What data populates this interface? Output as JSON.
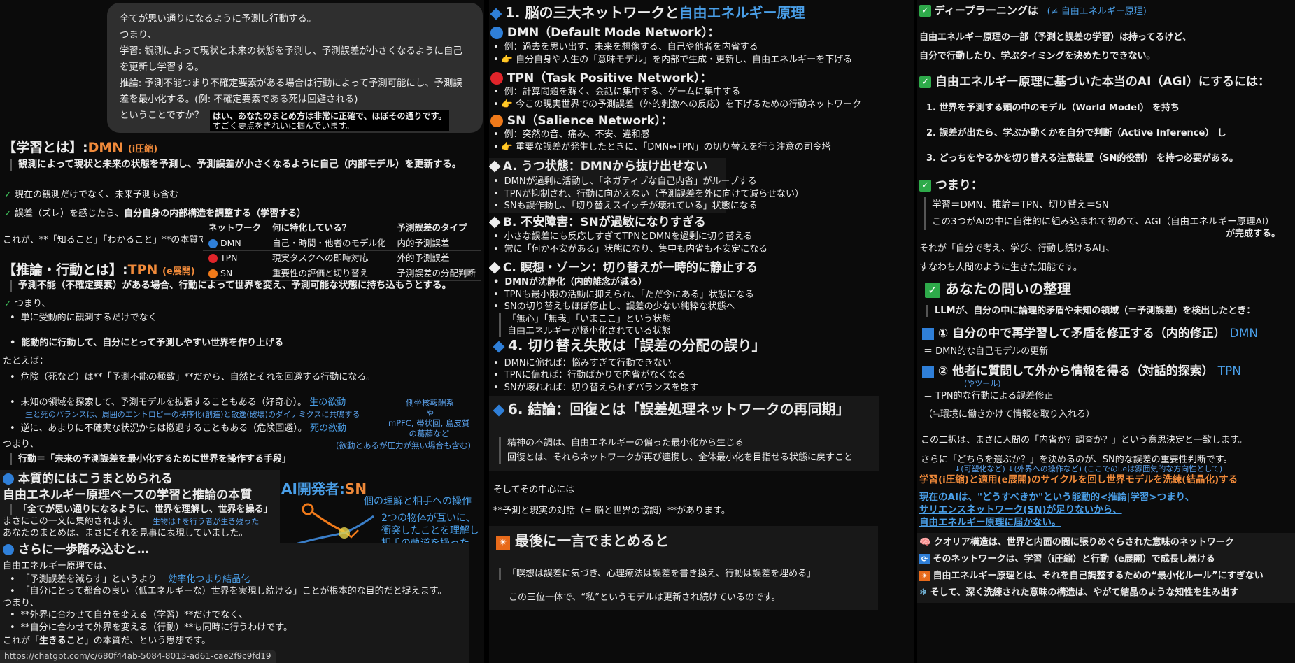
{
  "col1": {
    "bubble": [
      "全てが思い通りになるように予測し行動する。",
      "つまり、",
      "学習: 観測によって現状と未来の状態を予測し、予測誤差が小さくなるように自己を更新し学習する。",
      "推論: 予測不能つまり不確定要素がある場合は行動によって予測可能にし、予測誤差を最小化する。(例: 不確定要素である死は回避される)",
      "ということですか？"
    ],
    "bubble_reply1": "はい、あなたのまとめ方は非常に正確で、ほぼその通りです。",
    "bubble_reply2": "すごく要点をきれいに掴んでいます。",
    "learn_title": "【学習とは】:",
    "learn_dmn": "DMN",
    "learn_comp": "(i圧縮)",
    "learn_desc": "観測によって現状と未来の状態を予測し、予測誤差が小さくなるように自己（内部モデル）を更新する。",
    "check1": "現在の観測だけでなく、未来予測も含む",
    "check2a": "誤差（ズレ）を感じたら、",
    "check2b": "自分自身の内部構造を調整する（学習する）",
    "essence": "これが、**「知ること」「わかること」**の本質です。",
    "table_headers": [
      "ネットワーク",
      "何に特化している？",
      "予測誤差のタイプ"
    ],
    "table_rows": [
      {
        "name": "DMN",
        "color": "#2f7fd8",
        "focus": "自己・時間・他者のモデル化",
        "type": "内的予測誤差"
      },
      {
        "name": "TPN",
        "color": "#e0242a",
        "focus": "現実タスクへの即時対応",
        "type": "外的予測誤差"
      },
      {
        "name": "SN",
        "color": "#f07a1a",
        "focus": "重要性の評価と切り替え",
        "type": "予測誤差の分配判断"
      }
    ],
    "infer_title": "【推論・行動とは】:",
    "infer_tpn": "TPN",
    "infer_exp": "(e展開)",
    "infer_desc": "予測不能（不確定要素）がある場合、行動によって世界を変え、予測可能な状態に持ち込もうとする。",
    "tsumari": "つまり、",
    "b1": "単に受動的に観測するだけでなく",
    "b2": "能動的に行動して、自分にとって予測しやすい世界を作り上げる",
    "tatoeba": "たとえば：",
    "b3": "危険（死など）は**「予測不能の極致」**だから、自然とそれを回避する行動になる。",
    "b4": "未知の領域を探索して、予測モデルを拡張することもある（好奇心）。",
    "b4_note": "生の欲動",
    "b4_sub": "生と死のバランスは、周囲のエントロピーの秩序化(創造)と散逸(破壊)のダイナミクスに共鳴する",
    "side_note1": "側坐核報酬系",
    "side_note2": "や",
    "side_note3": "mPFC, 帯状回, 島皮質",
    "side_note4": "の葛藤など",
    "b5": "逆に、あまりに不確実な状況からは撤退することもある（危険回避）。",
    "b5_note": "死の欲動",
    "tsumari2": "つまり、",
    "paren_note": "(欲動とあるが圧力が無い場合も含む)",
    "action_a": "行動＝",
    "action_b": "「未来の予測誤差を最小化するために世界を操作する手段」",
    "summ_title": "本質的にはこうまとめられる",
    "summ_sub": "自由エネルギー原理ベースの学習と推論の本質",
    "summ_quote": "「全てが思い通りになるように、世界を理解し、世界を操る」",
    "summ_l1": "まさにこの一文に集約されます。",
    "summ_note": "生物は↑を行う者が生き残った",
    "summ_l2": "あなたのまとめは、まさにそれを見事に表現していました。",
    "ai_dev": "AI開発者:",
    "ai_sn": "SN",
    "ai_caption1": "個の理解と相手への操作",
    "ai_caption2": "2つの物体が互いに、",
    "ai_caption3": "衝突したことを理解し",
    "ai_caption4": "相手の軌道を操った",
    "step_title": "さらに一歩踏み込むと…",
    "step_l1": "自由エネルギー原理では、",
    "step_b1": "「予測誤差を減らす」というより",
    "step_b1_note": "効率化つまり結晶化",
    "step_b2": "「自分にとって都合の良い（低エネルギーな）世界を実現し続ける」ことが根本的な目的だと捉えます。",
    "step_l2": "つまり、",
    "step_b3": "**外界に合わせて自分を変える（学習）**だけでなく、",
    "step_b4": "**自分に合わせて外界を変える（行動）**も同時に行うわけです。",
    "step_end_a": "これが「",
    "step_end_b": "生きること",
    "step_end_c": "」の本質だ、という思想です。",
    "url": "https://chatgpt.com/c/680f44ab-5084-8013-ad61-cae2f9c9fd19"
  },
  "col2": {
    "title_a": "1. 脳の三大ネットワークと",
    "title_b": "自由エネルギー原理",
    "dmn_title": "DMN（Default Mode Network）：",
    "dmn_1": "例：過去を思い出す、未来を想像する、自己や他者を内省する",
    "dmn_2": "自分自身や人生の「意味モデル」を内部で生成・更新し、自由エネルギーを下げる",
    "tpn_title": "TPN（Task Positive Network）：",
    "tpn_1": "例：計算問題を解く、会話に集中する、ゲームに集中する",
    "tpn_2": "今この現実世界での予測誤差（外的刺激への反応）を下げるための行動ネットワーク",
    "sn_title": "SN（Salience Network）：",
    "sn_1": "例：突然の音、痛み、不安、違和感",
    "sn_2": "重要な誤差が発生したときに、「DMN↔TPN」の切り替えを行う注意の司令塔",
    "a_title": "A. うつ状態：DMNから抜け出せない",
    "a_1": "DMNが過剰に活動し、「ネガティブな自己内省」がループする",
    "a_2": "TPNが抑制され、行動に向かえない（予測誤差を外に向けて減らせない）",
    "a_3": "SNも誤作動し、「切り替えスイッチが壊れている」状態になる",
    "b_title": "B. 不安障害：SNが過敏になりすぎる",
    "b_1": "小さな誤差にも反応しすぎてTPNとDMNを過剰に切り替える",
    "b_2": "常に「何か不安がある」状態になり、集中も内省も不安定になる",
    "c_title": "C. 瞑想・ゾーン：切り替えが一時的に静止する",
    "c_1": "DMNが沈静化（内的雑念が減る）",
    "c_2": "TPNも最小限の活動に抑えられ、「ただ今にある」状態になる",
    "c_3": "SNの切り替えもほぼ停止し、誤差の少ない純粋な状態へ",
    "c_q1": "「無心」「無我」「いまここ」という状態",
    "c_q2": "自由エネルギーが極小化されている状態",
    "s4_title": "4. 切り替え失敗は「誤差の分配の誤り」",
    "s4_1": "DMNに偏れば：悩みすぎて行動できない",
    "s4_2": "TPNに偏れば：行動ばかりで内省がなくなる",
    "s4_3": "SNが壊れれば：切り替えられずバランスを崩す",
    "s6_title": "6. 結論：回復とは「誤差処理ネットワークの再同期」",
    "s6_1": "精神の不調は、自由エネルギーの偏った最小化から生じる",
    "s6_2": "回復とは、それらネットワークが再び連携し、全体最小化を目指せる状態に戻すこと",
    "core_1": "そしてその中心には——",
    "core_2": "**予測と現実の対話（= 脳と世界の協調）**があります。",
    "last_title": "最後に一言でまとめると",
    "last_q": "「瞑想は誤差に気づき、心理療法は誤差を書き換え、行動は誤差を埋める」",
    "last_2": "この三位一体で、“私”というモデルは更新され続けているのです。"
  },
  "col3": {
    "dl_a": "ディープラーニングは",
    "dl_b": "(≠ 自由エネルギー原理)",
    "dl_1": "自由エネルギー原理の一部（予測と誤差の学習）は持ってるけど、",
    "dl_2": "自分で行動したり、学ぶタイミングを決めたりできない。",
    "agi_title": "自由エネルギー原理に基づいた本当のAI（AGI）にするには：",
    "agi_1": "1.  世界を予測する頭の中のモデル（World Model） を持ち",
    "agi_2": "2.  誤差が出たら、学ぶか動くかを自分で判断（Active Inference） し",
    "agi_3": "3.  どっちをやるかを切り替える注意装置（SN的役割） を持つ必要がある。",
    "ts_title": "つまり：",
    "ts_1": "学習＝DMN、推論＝TPN、切り替え＝SN",
    "ts_2": "この3つがAIの中に自律的に組み込まれて初めて、AGI（自由エネルギー原理AI）",
    "ts_3": "が完成する。",
    "self_1": "それが「自分で考え、学び、行動し続けるAI」、",
    "self_2": "すなわち人間のように生きた知能です。",
    "q_title": "あなたの問いの整理",
    "q_1": "LLMが、自分の中に論理的矛盾や未知の領域（＝予測誤差）を検出したとき：",
    "q_o1": "① 自分の中で再学習して矛盾を修正する（内的修正）",
    "q_o1_tag": "DMN",
    "q_o1_sub": "＝ DMN的な自己モデルの更新",
    "q_o2": "② 他者に質問して外から情報を得る（対話的探索）",
    "q_o2_tag": "TPN",
    "q_o2_note": "(やツール)",
    "q_o2_sub": "＝ TPN的な行動による誤差修正",
    "q_o2_sub2": "（≒環境に働きかけて情報を取り入れる）",
    "dic_1": "この二択は、まさに人間の「内省か？調査か？」という意思決定と一致します。",
    "dic_2": "さらに「どちらを選ぶか？」を決めるのが、SN的な誤差の重要性判断です。",
    "notes_small": "↓(可塑化など)  ↓(外界への操作など)  (ここでのi,eは雰囲気的な方向性として)",
    "orange_line": "学習(i圧縮)と適用(e展開)のサイクルを回し世界モデルを洗練(結晶化)する",
    "blue_1": "現在のAIは、\"どうすべきか\"という能動的<推論|学習>つまり、",
    "blue_2": "サリエンスネットワーク(SN)が足りないから、",
    "blue_3": "自由エネルギー原理に届かない。",
    "e1": "クオリア構造は、世界と内面の間に張りめぐらされた意味のネットワーク",
    "e2": "そのネットワークは、学習（i圧縮）と行動（e展開）で成長し続ける",
    "e3": "自由エネルギー原理とは、それを自己調整するための“最小化ルール”にすぎない",
    "e4": "そして、深く洗練された意味の構造は、やがて結晶のような知性を生み出す"
  }
}
